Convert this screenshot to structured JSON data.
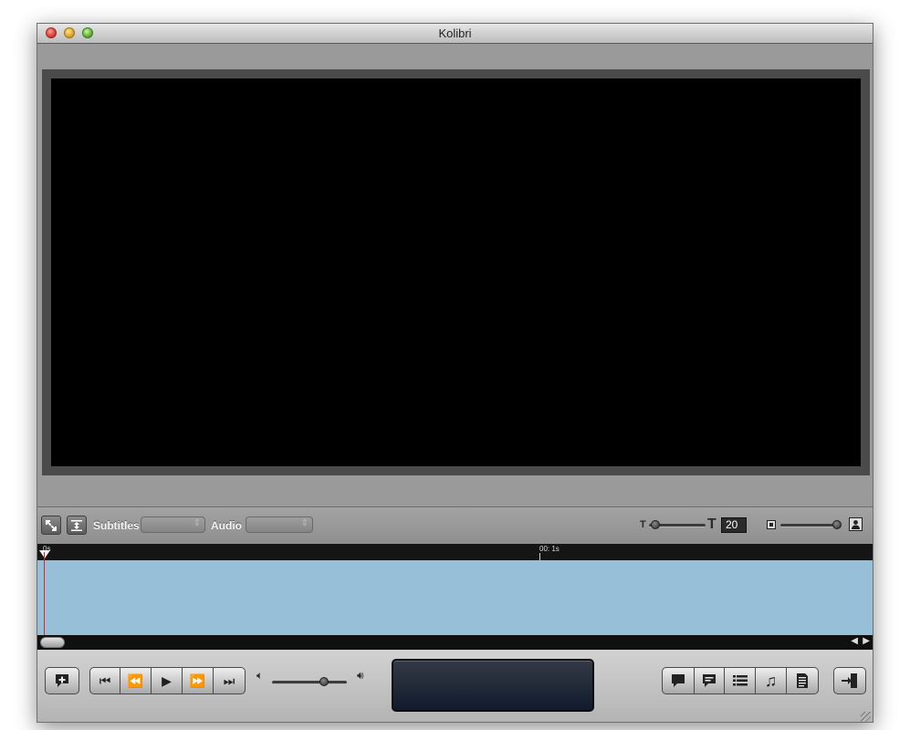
{
  "window": {
    "title": "Kolibri"
  },
  "toolbar": {
    "subtitles_label": "Subtitles",
    "subtitles_value": "",
    "audio_label": "Audio",
    "audio_value": "",
    "font_size_value": "20",
    "font_small_icon": "T",
    "font_large_icon": "T"
  },
  "timeline": {
    "start_label": "0s",
    "marker_label": "00: 1s"
  },
  "controls": {
    "add_subtitle_icon": "add-subtitle-icon",
    "transport": [
      "skip-back-icon",
      "rewind-icon",
      "play-icon",
      "fast-forward-icon",
      "skip-forward-icon"
    ],
    "right_group": [
      "speech-bubble-icon",
      "caption-bubble-icon",
      "list-icon",
      "music-note-icon",
      "document-icon"
    ],
    "export_icon": "export-icon"
  },
  "colors": {
    "track": "#97bfd7",
    "playhead_line": "#d8262a",
    "lcd": "#1a2335"
  }
}
